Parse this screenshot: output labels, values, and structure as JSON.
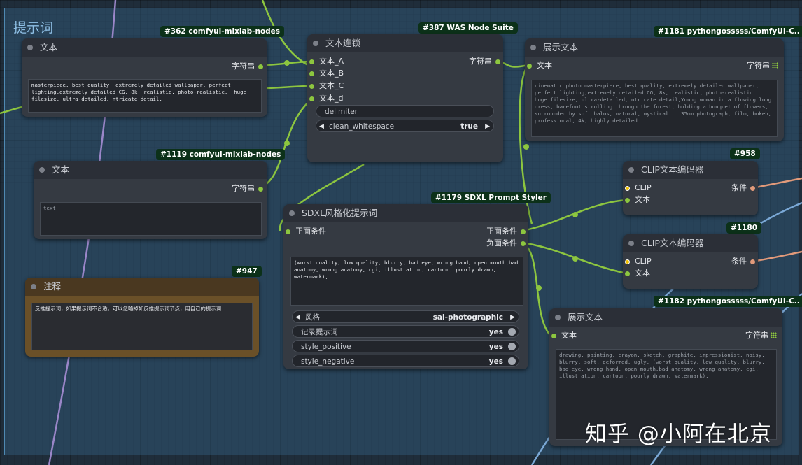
{
  "group": {
    "title": "提示词"
  },
  "colors": {
    "wire_string": "#8dc63f",
    "wire_clip": "#e29a7a",
    "wire_blue": "#7aa8d6",
    "wire_purple": "#9a86c8",
    "badge_bg": "#0c3119"
  },
  "nodes": {
    "text1": {
      "badge": "#362 comfyui-mixlab-nodes",
      "title": "文本",
      "output_label": "字符串",
      "text": "masterpiece, best quality, extremely detailed wallpaper, perfect lighting,extremely detailed CG, 8k, realistic, photo-realistic,  huge filesize, ultra-detailed, ntricate detail,"
    },
    "text2": {
      "badge": "#1119 comfyui-mixlab-nodes",
      "title": "文本",
      "output_label": "字符串",
      "placeholder": "text"
    },
    "note": {
      "badge": "#947",
      "title": "注释",
      "text": "反推提示词，如果提示词不合适，可以忽略掉如反推提示词节点，用自己的提示词"
    },
    "concat": {
      "badge": "#387 WAS Node Suite",
      "title": "文本连锁",
      "output_label": "字符串",
      "inputs": [
        "文本_A",
        "文本_B",
        "文本_C",
        "文本_d"
      ],
      "delimiter_label": "delimiter",
      "clean_label": "clean_whitespace",
      "clean_value": "true"
    },
    "show1": {
      "badge": "#1181 pythongosssss/ComfyUI-C..",
      "title": "展示文本",
      "input_label": "文本",
      "output_label": "字符串",
      "text": "cinematic photo masterpiece, best quality, extremely detailed wallpaper, perfect lighting,extremely detailed CG, 8k, realistic, photo-realistic,  huge filesize, ultra-detailed, ntricate detail,Young woman in a flowing long dress, barefoot strolling through the forest, holding a bouquet of flowers, surrounded by soft halos, natural, mystical. . 35mm photograph, film, bokeh, professional, 4k, highly detailed"
    },
    "styler": {
      "badge": "#1179 SDXL Prompt Styler",
      "title": "SDXL风格化提示词",
      "input_label": "正面条件",
      "output_pos": "正面条件",
      "output_neg": "负面条件",
      "text": "(worst quality, low quality, blurry, bad eye, wrong hand, open mouth,bad anatomy, wrong anatomy, cgi, illustration, cartoon, poorly drawn, watermark),",
      "style_label": "风格",
      "style_value": "sai-photographic",
      "log_label": "记录提示词",
      "log_value": "yes",
      "sp_label": "style_positive",
      "sp_value": "yes",
      "sn_label": "style_negative",
      "sn_value": "yes"
    },
    "clip1": {
      "badge": "#958",
      "title": "CLIP文本编码器",
      "in_clip": "CLIP",
      "in_text": "文本",
      "output_label": "条件"
    },
    "clip2": {
      "badge": "#1180",
      "title": "CLIP文本编码器",
      "in_clip": "CLIP",
      "in_text": "文本",
      "output_label": "条件"
    },
    "show2": {
      "badge": "#1182 pythongosssss/ComfyUI-C..",
      "title": "展示文本",
      "input_label": "文本",
      "output_label": "字符串",
      "text": "drawing, painting, crayon, sketch, graphite, impressionist, noisy, blurry, soft, deformed, ugly, (worst quality, low quality, blurry, bad eye, wrong hand, open mouth,bad anatomy, wrong anatomy, cgi, illustration, cartoon, poorly drawn, watermark),"
    }
  },
  "watermark": "知乎 @小阿在北京"
}
